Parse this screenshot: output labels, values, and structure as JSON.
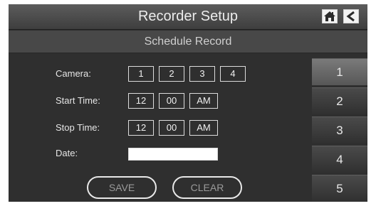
{
  "header": {
    "title": "Recorder Setup"
  },
  "subheader": {
    "title": "Schedule Record"
  },
  "form": {
    "camera": {
      "label": "Camera:",
      "options": [
        "1",
        "2",
        "3",
        "4"
      ]
    },
    "start_time": {
      "label": "Start Time:",
      "hour": "12",
      "minute": "00",
      "period": "AM"
    },
    "stop_time": {
      "label": "Stop Time:",
      "hour": "12",
      "minute": "00",
      "period": "AM"
    },
    "date": {
      "label": "Date:",
      "value": ""
    },
    "save_label": "SAVE",
    "clear_label": "CLEAR"
  },
  "side_menu": {
    "items": [
      "1",
      "2",
      "3",
      "4",
      "5"
    ],
    "selected": "1"
  },
  "icons": {
    "home": "home-icon",
    "back": "back-arrow-icon"
  },
  "colors": {
    "background": "#2f2f2f",
    "text": "#e6e6e6",
    "disabled_text": "#9a9a9a",
    "frame": "#dcdcdc"
  }
}
